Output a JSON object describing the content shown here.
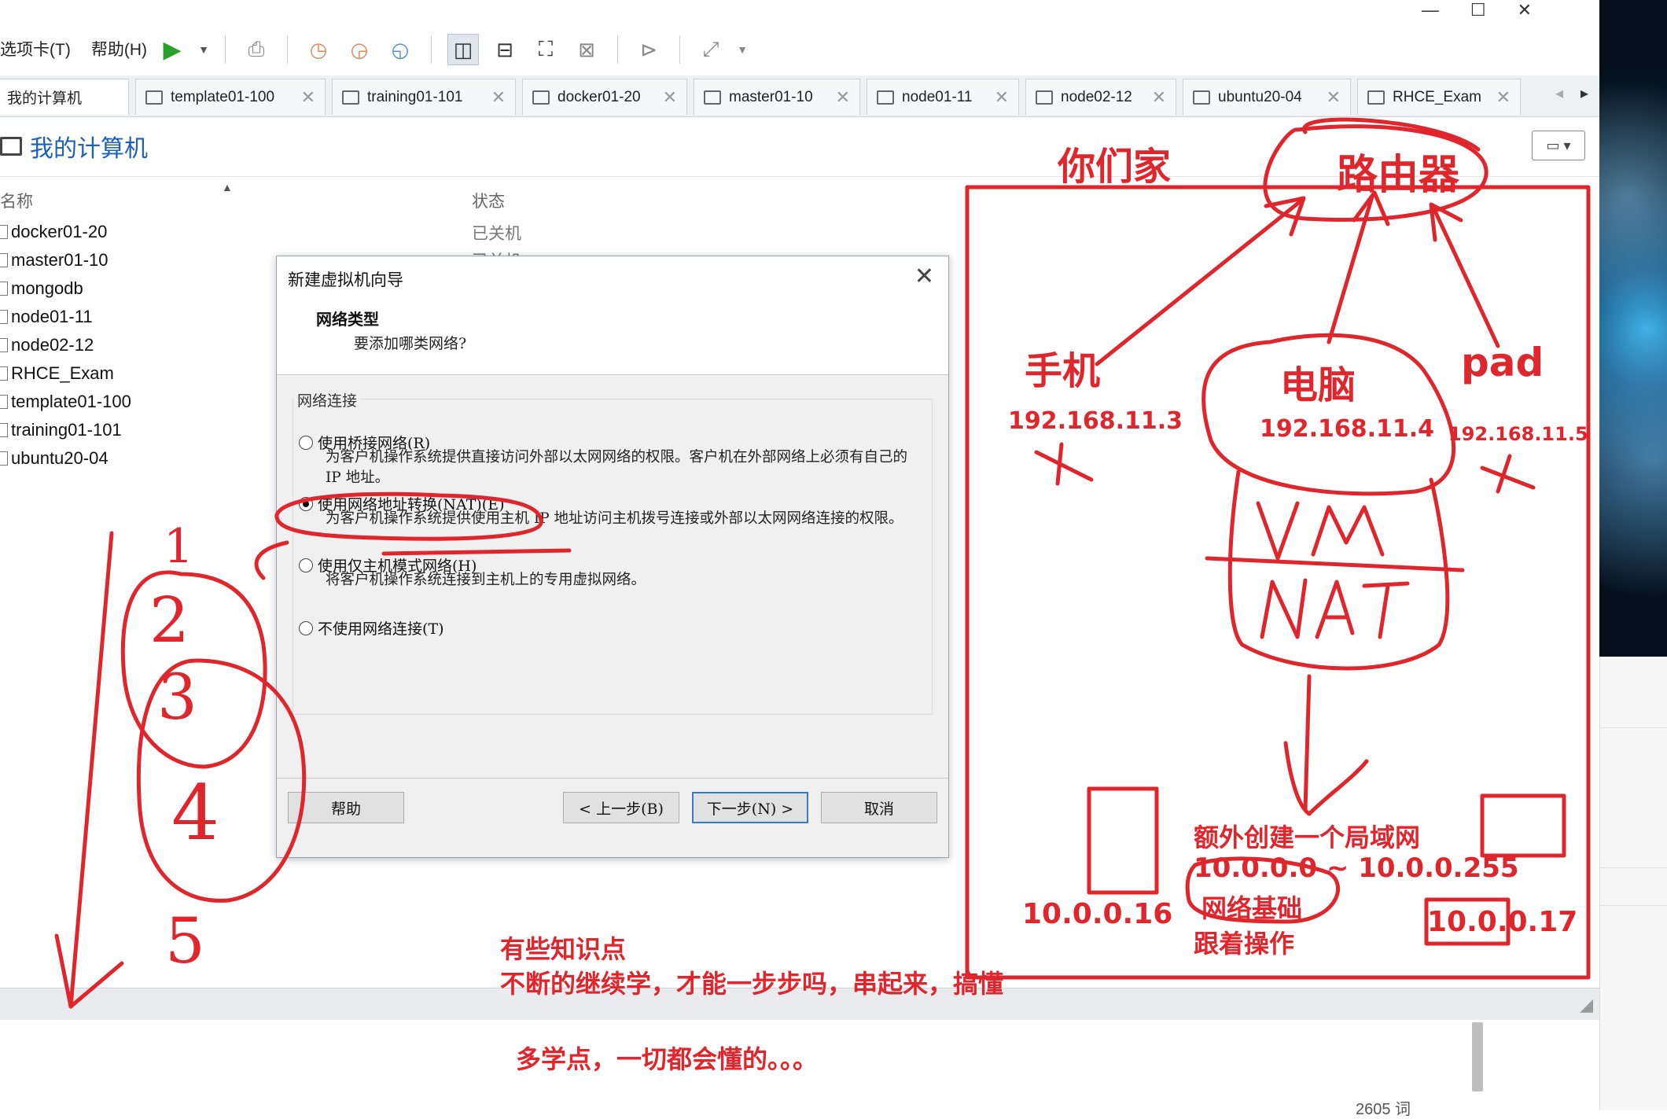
{
  "window": {
    "controls": [
      "—",
      "☐",
      "✕"
    ]
  },
  "menu": {
    "tabs_label": "选项卡(T)",
    "help_label": "帮助(H)"
  },
  "tabs": [
    {
      "label": "我的计算机"
    },
    {
      "label": "template01-100"
    },
    {
      "label": "training01-101"
    },
    {
      "label": "docker01-20"
    },
    {
      "label": "master01-10"
    },
    {
      "label": "node01-11"
    },
    {
      "label": "node02-12"
    },
    {
      "label": "ubuntu20-04"
    },
    {
      "label": "RHCE_Exam"
    }
  ],
  "page": {
    "title": "我的计算机"
  },
  "table": {
    "col_name": "名称",
    "col_state": "状态",
    "rows": [
      "docker01-20",
      "master01-10",
      "mongodb",
      "node01-11",
      "node02-12",
      "RHCE_Exam",
      "template01-100",
      "training01-101",
      "ubuntu20-04"
    ],
    "state_first": "已关机",
    "state_second": "已关机"
  },
  "dialog": {
    "title": "新建虚拟机向导",
    "heading": "网络类型",
    "subheading": "要添加哪类网络?",
    "group_label": "网络连接",
    "options": [
      {
        "label": "使用桥接网络(R)",
        "desc": "为客户机操作系统提供直接访问外部以太网网络的权限。客户机在外部网络上必须有自己的 IP 地址。",
        "selected": false
      },
      {
        "label": "使用网络地址转换(NAT)(E)",
        "desc": "为客户机操作系统提供使用主机 IP 地址访问主机拨号连接或外部以太网网络连接的权限。",
        "selected": true
      },
      {
        "label": "使用仅主机模式网络(H)",
        "desc": "将客户机操作系统连接到主机上的专用虚拟网络。",
        "selected": false
      },
      {
        "label": "不使用网络连接(T)",
        "desc": "",
        "selected": false
      }
    ],
    "buttons": {
      "help": "帮助",
      "back": "< 上一步(B)",
      "next": "下一步(N) >",
      "cancel": "取消"
    }
  },
  "annotations": {
    "home": "你们家",
    "router": "路由器",
    "phone": "手机",
    "phone_ip": "192.168.11.3",
    "pc": "电脑",
    "pc_ip": "192.168.11.4",
    "pad": "pad",
    "pad_ip": "192.168.11.5",
    "vm": "VM",
    "nat": "NAT",
    "lan_title": "额外创建一个局域网",
    "lan_range": "10.0.0.0 ~ 10.0.0.255",
    "net_basics": "网络基础",
    "follow": "跟着操作",
    "ip_a": "10.0.0.16",
    "ip_b": "10.0.0.17",
    "note1": "有些知识点",
    "note2": "不断的继续学，才能一步步吗，串起来，搞懂",
    "note3": "多学点，一切都会懂的。。。",
    "steps": [
      "1",
      "2",
      "3",
      "4",
      "5"
    ],
    "color": "#e0262d"
  },
  "doc": {
    "word_count": "2605 词"
  }
}
